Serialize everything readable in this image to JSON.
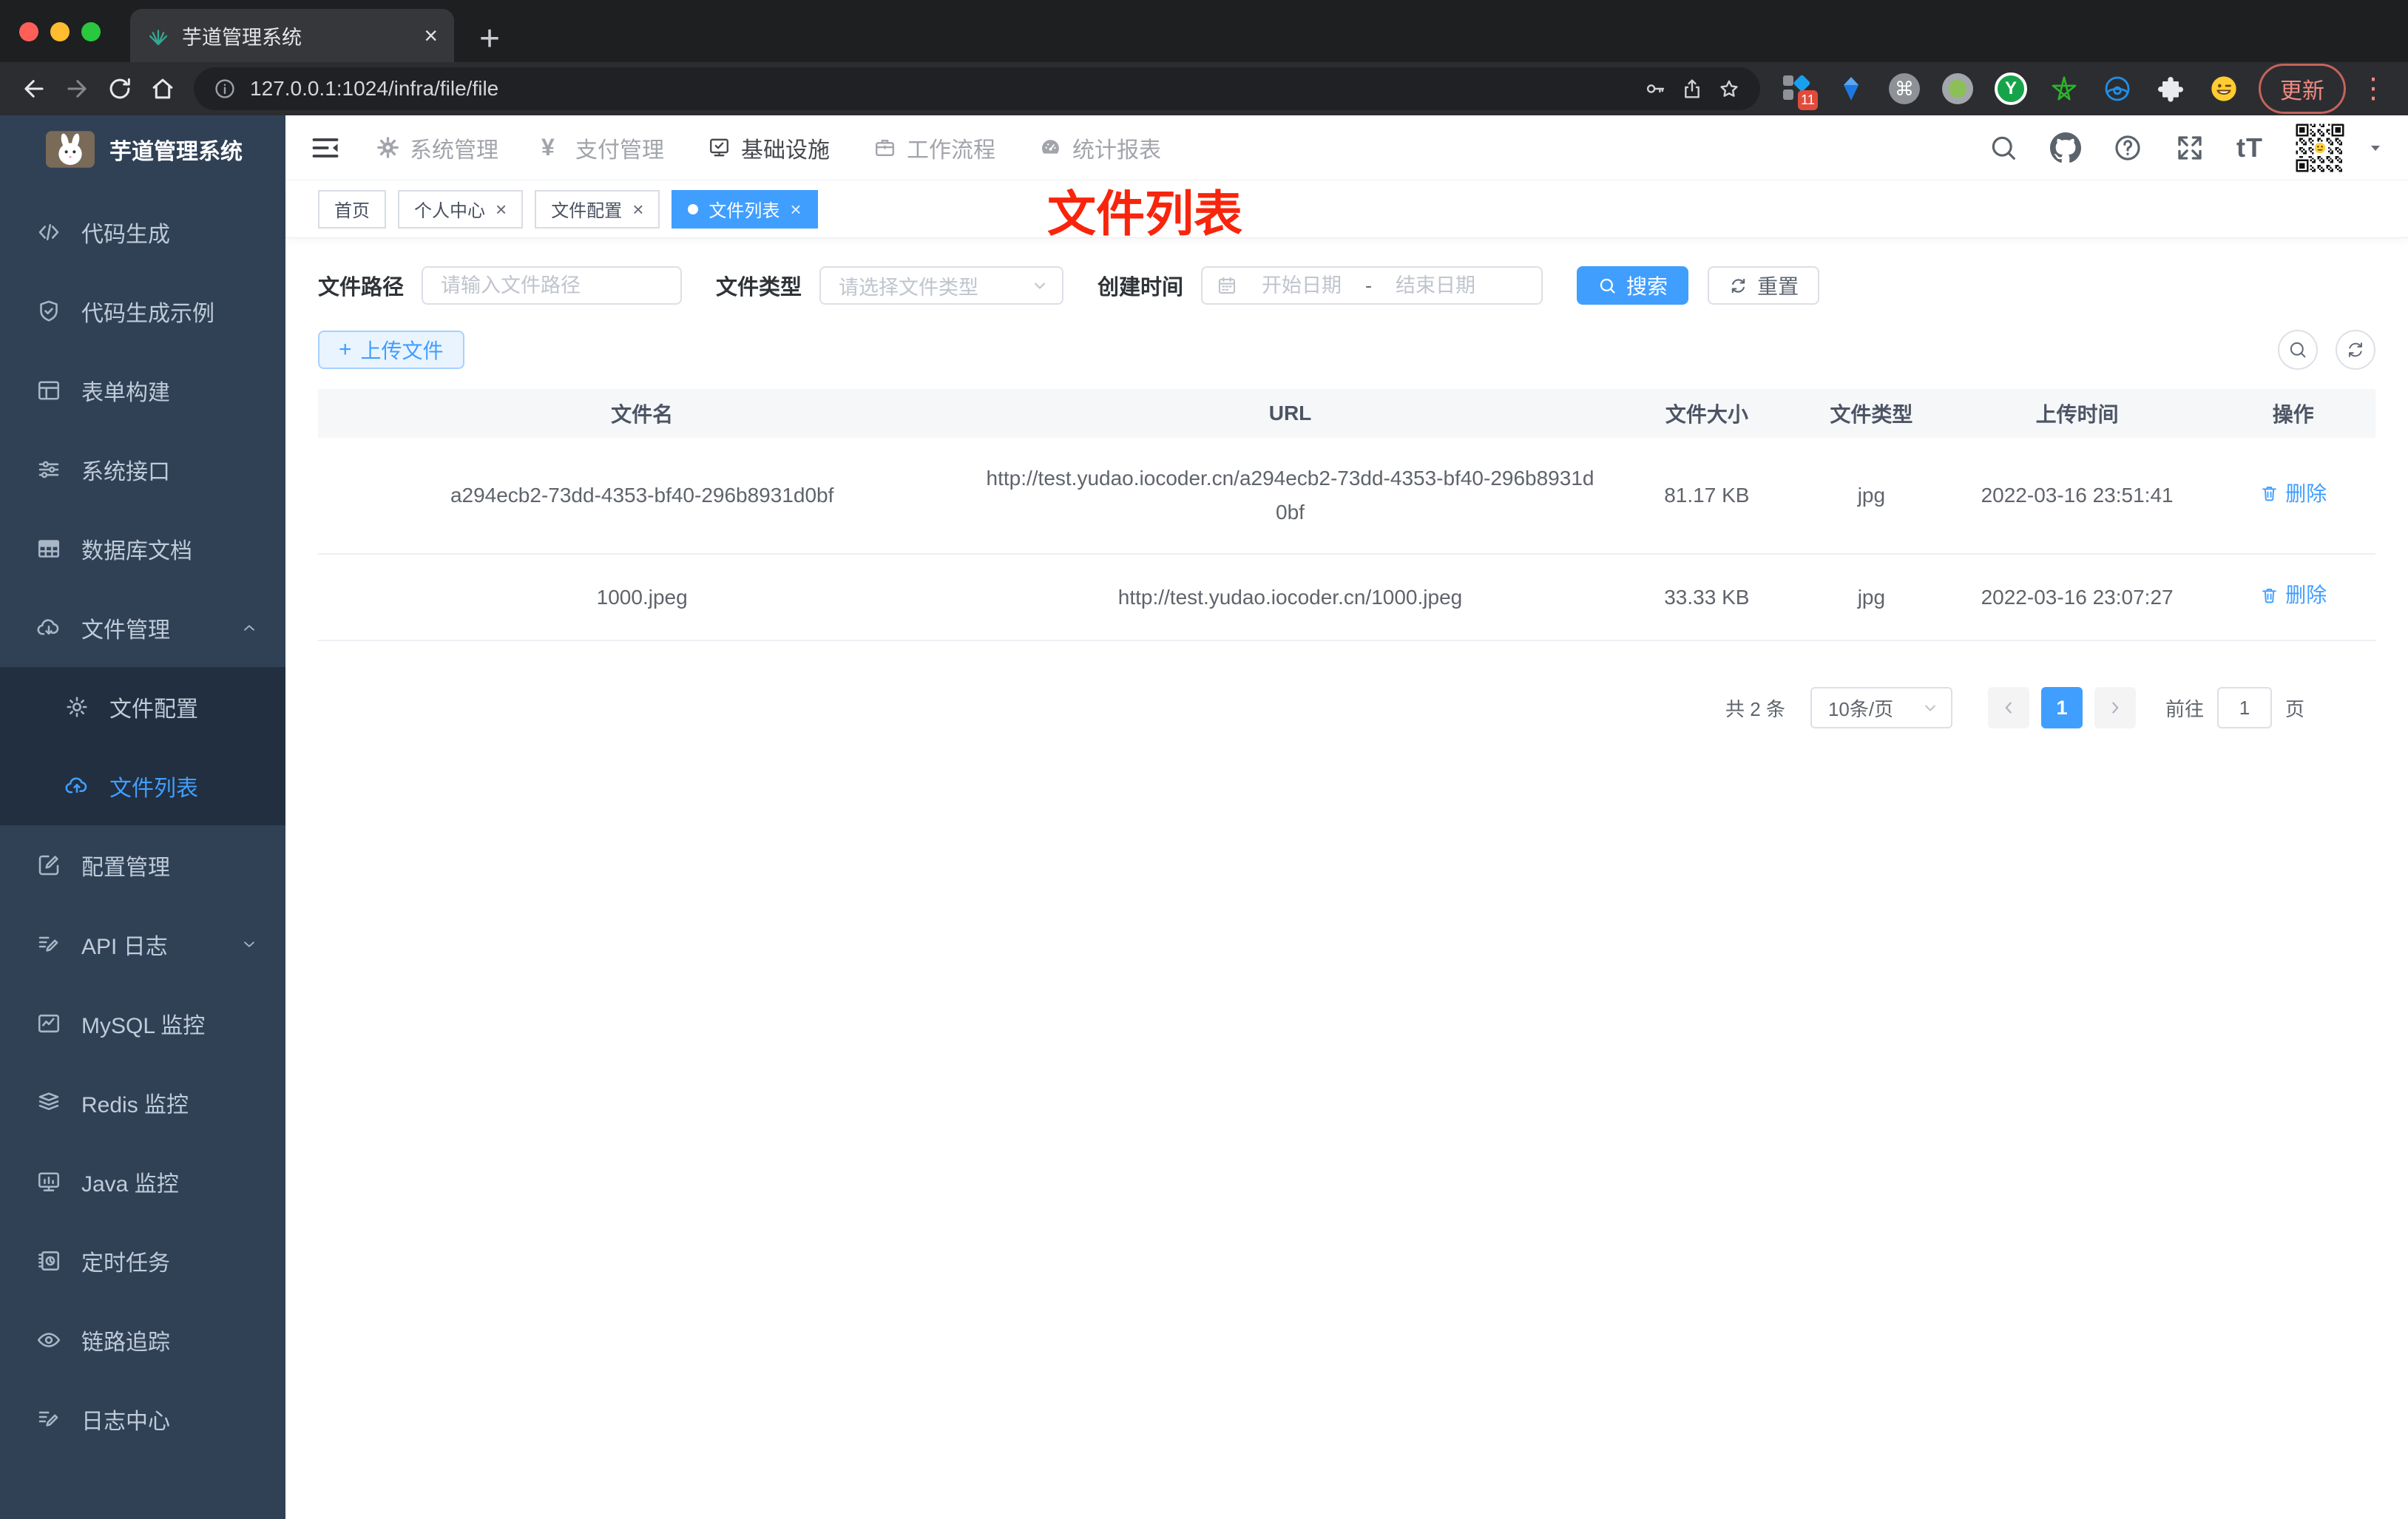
{
  "colors": {
    "accent": "#409eff",
    "annotation_red": "#f8250c",
    "sidebar_bg": "#304156",
    "sidebar_submenu_bg": "#212f40",
    "sidebar_text": "#c0cbd9"
  },
  "glyphs": {
    "plus": "+",
    "close": "×",
    "dots": "⋮",
    "cmd": "⌘",
    "y": "Y",
    "text_size": "tT",
    "yen": "¥"
  },
  "browser": {
    "tab_title": "芋道管理系统",
    "url": "127.0.0.1:1024/infra/file/file",
    "update_label": "更新",
    "ext_badge": "11"
  },
  "sidebar": {
    "title": "芋道管理系统",
    "items": [
      {
        "label": "代码生成",
        "icon": "code"
      },
      {
        "label": "代码生成示例",
        "icon": "shield-check"
      },
      {
        "label": "表单构建",
        "icon": "form"
      },
      {
        "label": "系统接口",
        "icon": "sliders"
      },
      {
        "label": "数据库文档",
        "icon": "db-grid"
      },
      {
        "label": "文件管理",
        "icon": "cloud-download",
        "chevron": "up"
      },
      {
        "label": "文件配置",
        "icon": "gear",
        "sub": true
      },
      {
        "label": "文件列表",
        "icon": "cloud-upload",
        "sub": true,
        "active": true
      },
      {
        "label": "配置管理",
        "icon": "edit-square"
      },
      {
        "label": "API 日志",
        "icon": "edit-lines",
        "chevron": "down"
      },
      {
        "label": "MySQL 监控",
        "icon": "chart-box"
      },
      {
        "label": "Redis 监控",
        "icon": "layers"
      },
      {
        "label": "Java 监控",
        "icon": "monitor"
      },
      {
        "label": "定时任务",
        "icon": "schedule"
      },
      {
        "label": "链路追踪",
        "icon": "eye"
      },
      {
        "label": "日志中心",
        "icon": "log-edit"
      }
    ]
  },
  "header": {
    "nav": [
      {
        "label": "系统管理",
        "icon": "nav-gear"
      },
      {
        "label": "支付管理",
        "icon": "nav-yen"
      },
      {
        "label": "基础设施",
        "icon": "nav-infra",
        "active": true
      },
      {
        "label": "工作流程",
        "icon": "nav-work"
      },
      {
        "label": "统计报表",
        "icon": "nav-report"
      }
    ]
  },
  "tags": {
    "items": [
      {
        "label": "首页",
        "closable": false,
        "active": false
      },
      {
        "label": "个人中心",
        "closable": true,
        "active": false
      },
      {
        "label": "文件配置",
        "closable": true,
        "active": false
      },
      {
        "label": "文件列表",
        "closable": true,
        "active": true
      }
    ]
  },
  "annotation": {
    "text": "文件列表"
  },
  "filters": {
    "path_label": "文件路径",
    "path_placeholder": "请输入文件路径",
    "type_label": "文件类型",
    "type_placeholder": "请选择文件类型",
    "time_label": "创建时间",
    "start_placeholder": "开始日期",
    "range_separator": "-",
    "end_placeholder": "结束日期",
    "search_label": "搜索",
    "reset_label": "重置"
  },
  "toolbar": {
    "upload_label": "上传文件"
  },
  "table": {
    "headers": [
      "文件名",
      "URL",
      "文件大小",
      "文件类型",
      "上传时间",
      "操作"
    ],
    "rows": [
      {
        "name": "a294ecb2-73dd-4353-bf40-296b8931d0bf",
        "url": "http://test.yudao.iocoder.cn/a294ecb2-73dd-4353-bf40-296b8931d0bf",
        "size": "81.17 KB",
        "type": "jpg",
        "time": "2022-03-16 23:51:41",
        "action": "删除"
      },
      {
        "name": "1000.jpeg",
        "url": "http://test.yudao.iocoder.cn/1000.jpeg",
        "size": "33.33 KB",
        "type": "jpg",
        "time": "2022-03-16 23:07:27",
        "action": "删除"
      }
    ]
  },
  "pagination": {
    "total": "共 2 条",
    "per_page": "10条/页",
    "page": "1",
    "goto_label": "前往",
    "goto_value": "1",
    "page_unit": "页"
  }
}
